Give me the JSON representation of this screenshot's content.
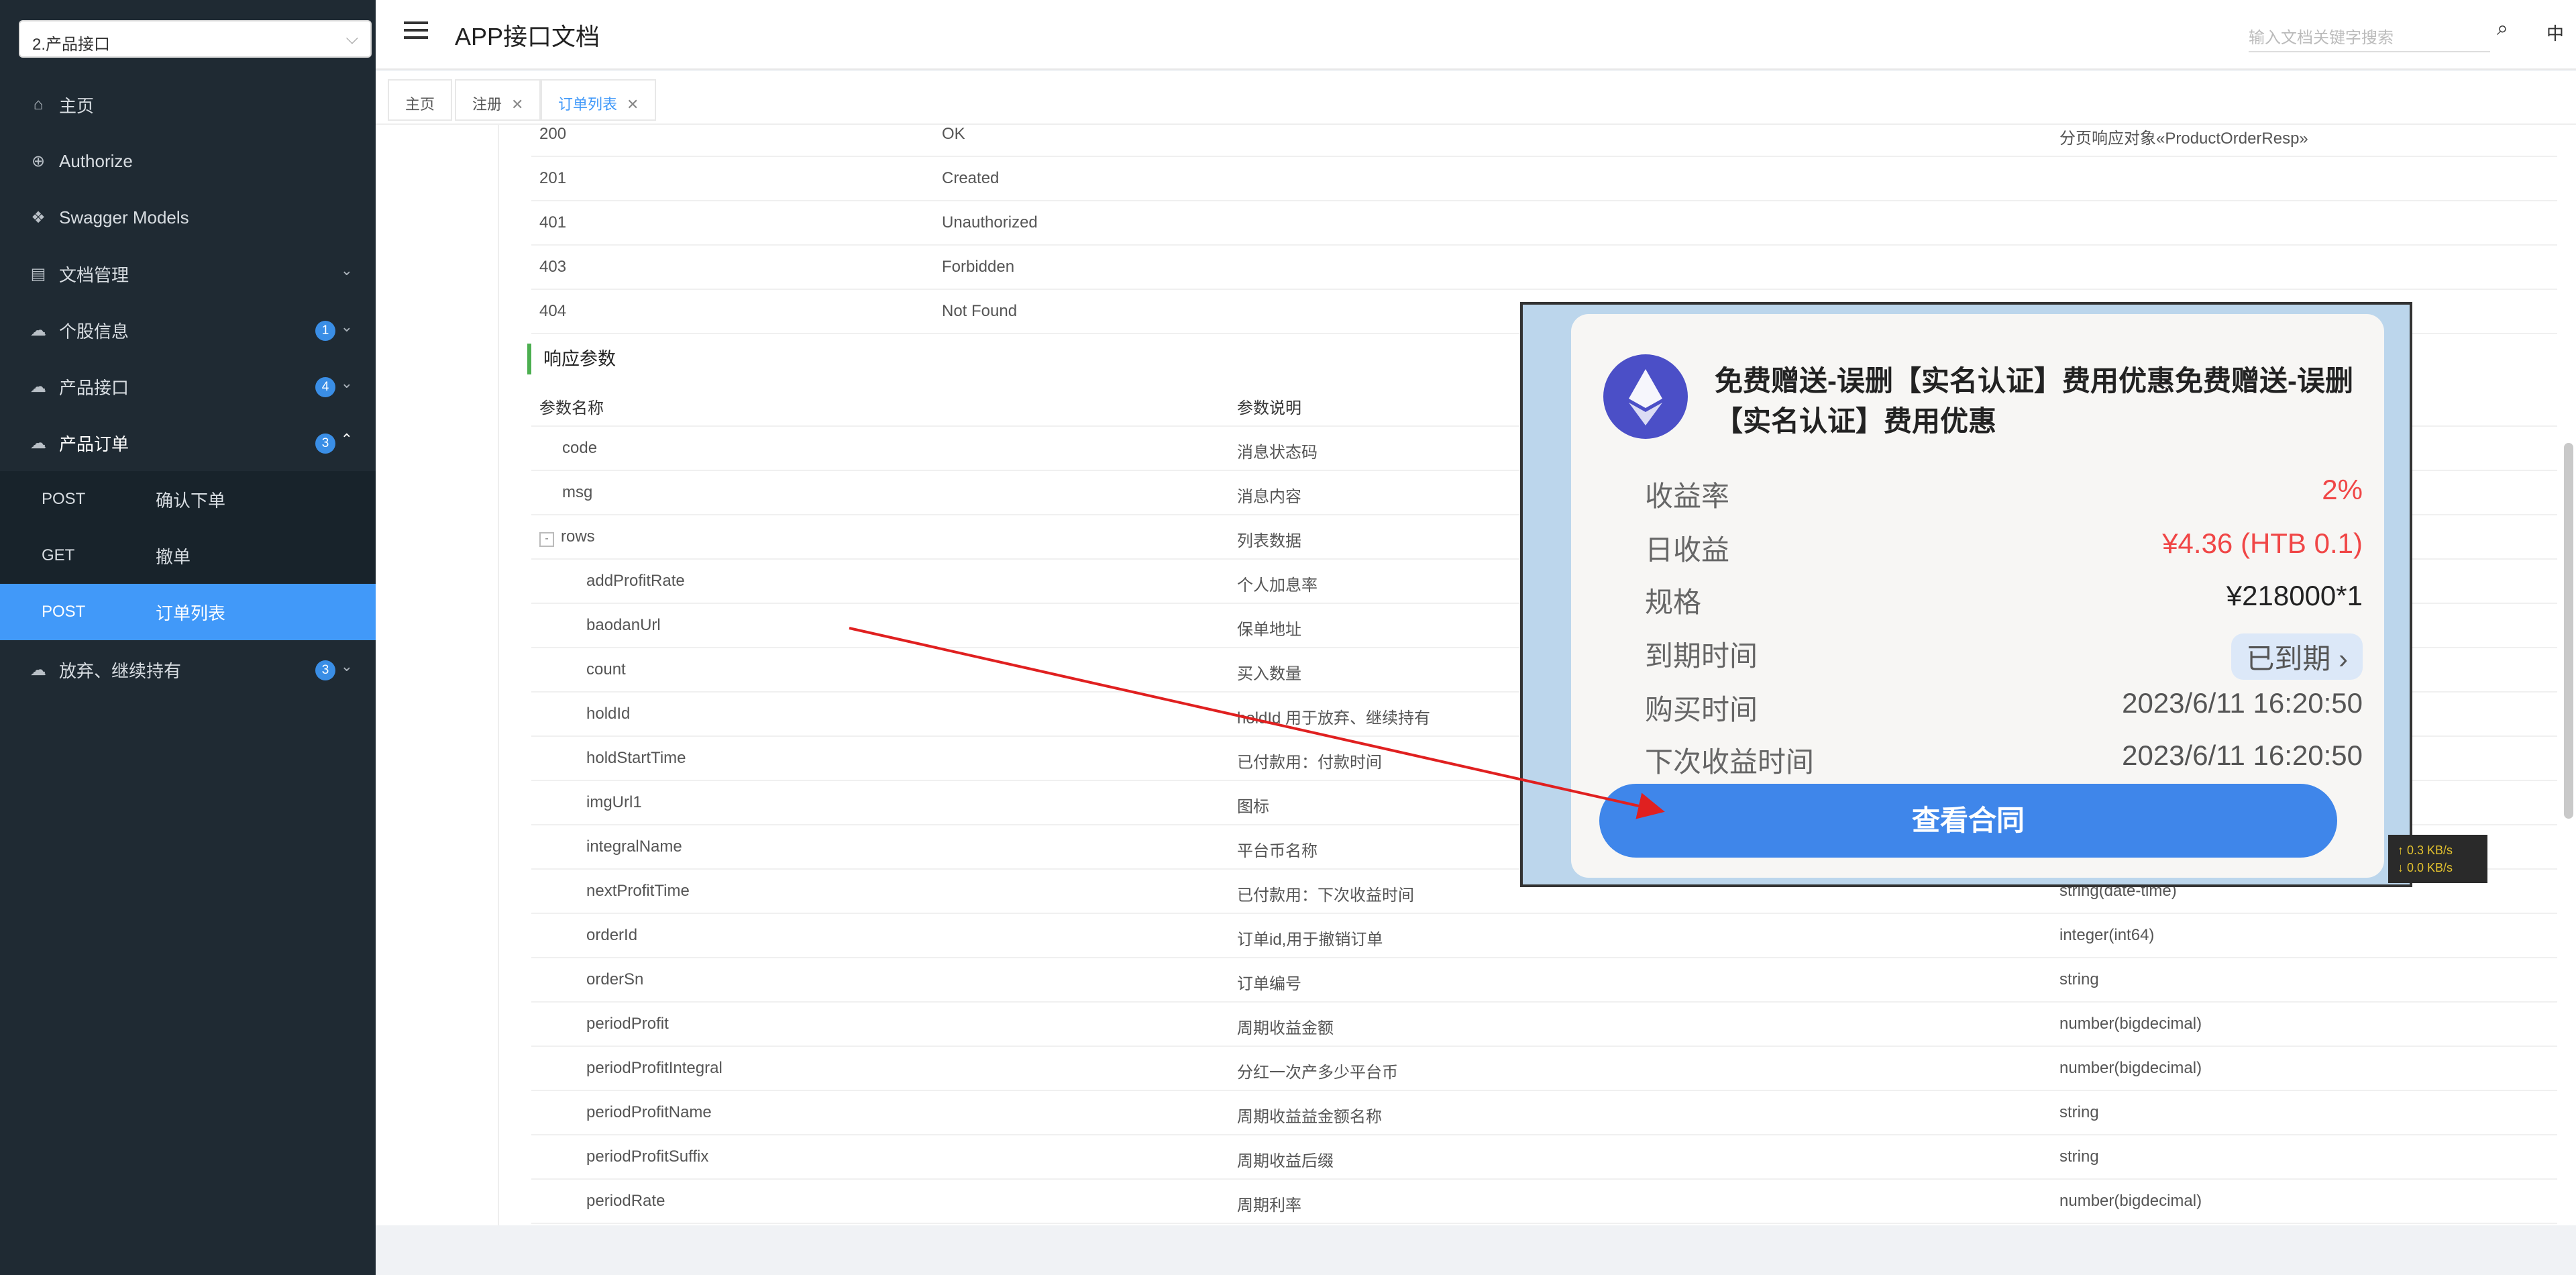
{
  "sidebar": {
    "selector": "2.产品接口",
    "items": [
      {
        "label": "主页"
      },
      {
        "label": "Authorize"
      },
      {
        "label": "Swagger Models"
      },
      {
        "label": "文档管理"
      },
      {
        "label": "个股信息",
        "badge": "1"
      },
      {
        "label": "产品接口",
        "badge": "4"
      },
      {
        "label": "产品订单",
        "badge": "3"
      },
      {
        "label": "放弃、继续持有",
        "badge": "3"
      }
    ],
    "subitems": [
      {
        "method": "POST",
        "label": "确认下单"
      },
      {
        "method": "GET",
        "label": "撤单"
      },
      {
        "method": "POST",
        "label": "订单列表"
      }
    ]
  },
  "header": {
    "title": "APP接口文档",
    "search_placeholder": "输入文档关键字搜索",
    "lang": "中"
  },
  "tabs": [
    "主页",
    "注册",
    "订单列表"
  ],
  "responses": [
    {
      "code": "200",
      "desc": "OK",
      "schema": "分页响应对象«ProductOrderResp»"
    },
    {
      "code": "201",
      "desc": "Created",
      "schema": ""
    },
    {
      "code": "401",
      "desc": "Unauthorized",
      "schema": ""
    },
    {
      "code": "403",
      "desc": "Forbidden",
      "schema": ""
    },
    {
      "code": "404",
      "desc": "Not Found",
      "schema": ""
    }
  ],
  "response_params": {
    "title": "响应参数",
    "col_name": "参数名称",
    "col_desc": "参数说明",
    "rows": [
      {
        "name": "code",
        "desc": "消息状态码",
        "type": ""
      },
      {
        "name": "msg",
        "desc": "消息内容",
        "type": ""
      },
      {
        "name": "rows",
        "desc": "列表数据",
        "type": "",
        "toggle": "-"
      },
      {
        "name": "addProfitRate",
        "desc": "个人加息率",
        "type": ""
      },
      {
        "name": "baodanUrl",
        "desc": "保单地址",
        "type": ""
      },
      {
        "name": "count",
        "desc": "买入数量",
        "type": ""
      },
      {
        "name": "holdId",
        "desc": "holdId 用于放弃、继续持有",
        "type": ""
      },
      {
        "name": "holdStartTime",
        "desc": "已付款用：付款时间",
        "type": ""
      },
      {
        "name": "imgUrl1",
        "desc": "图标",
        "type": ""
      },
      {
        "name": "integralName",
        "desc": "平台币名称",
        "type": ""
      },
      {
        "name": "nextProfitTime",
        "desc": "已付款用：下次收益时间",
        "type": "string(date-time)"
      },
      {
        "name": "orderId",
        "desc": "订单id,用于撤销订单",
        "type": "integer(int64)"
      },
      {
        "name": "orderSn",
        "desc": "订单编号",
        "type": "string"
      },
      {
        "name": "periodProfit",
        "desc": "周期收益金额",
        "type": "number(bigdecimal)"
      },
      {
        "name": "periodProfitIntegral",
        "desc": "分红一次产多少平台币",
        "type": "number(bigdecimal)"
      },
      {
        "name": "periodProfitName",
        "desc": "周期收益益金额名称",
        "type": "string"
      },
      {
        "name": "periodProfitSuffix",
        "desc": "周期收益后缀",
        "type": "string"
      },
      {
        "name": "periodRate",
        "desc": "周期利率",
        "type": "number(bigdecimal)"
      }
    ]
  },
  "overlay_card": {
    "title": "免费赠送-误删【实名认证】费用优惠免费赠送-误删【实名认证】费用优惠",
    "fields": [
      {
        "key": "收益率",
        "value": "2%",
        "color": "red"
      },
      {
        "key": "日收益",
        "value": "¥4.36 (HTB 0.1)",
        "color": "red"
      },
      {
        "key": "规格",
        "value": "¥218000*1",
        "color": "dark"
      },
      {
        "key": "到期时间",
        "value": "已到期 ›",
        "color": "pill"
      },
      {
        "key": "购买时间",
        "value": "2023/6/11 16:20:50",
        "color": "normal"
      },
      {
        "key": "下次收益时间",
        "value": "2023/6/11 16:20:50",
        "color": "normal"
      }
    ],
    "button": "查看合同"
  },
  "netspeed": {
    "up": "↑ 0.3 KB/s",
    "down": "↓ 0.0 KB/s"
  },
  "colors": {
    "accent": "#4199f9",
    "sidebar_bg": "#1f2a33",
    "arrow": "#e02020",
    "badge": "#3a8ee6"
  }
}
